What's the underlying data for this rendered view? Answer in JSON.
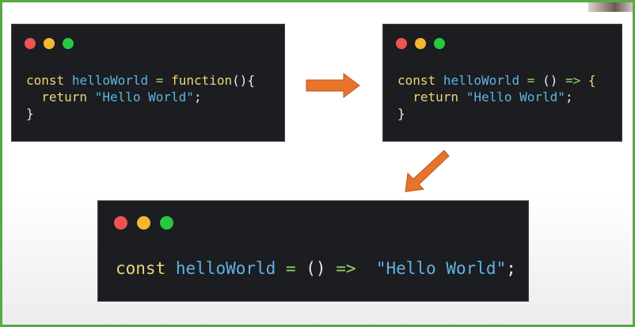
{
  "colors": {
    "frame_border": "#58a845",
    "window_bg": "#1b1d20",
    "keyword": "#f0d575",
    "identifier": "#5fb3e6",
    "operator": "#9ad26a",
    "arrow": "#e8732b"
  },
  "window1": {
    "line1": {
      "kw": "const",
      "id": "helloWorld",
      "op": "=",
      "fn": "function",
      "punc": "(){"
    },
    "line2": {
      "kw": "return",
      "str": "\"Hello World\"",
      "punc": ";"
    },
    "line3": {
      "punc": "}"
    }
  },
  "window2": {
    "line1": {
      "kw": "const",
      "id": "helloWorld",
      "op": "=",
      "parens": "()",
      "arrow": "=>",
      "brace": "{"
    },
    "line2": {
      "kw": "return",
      "str": "\"Hello World\"",
      "punc": ";"
    },
    "line3": {
      "punc": "}"
    }
  },
  "window3": {
    "line1": {
      "kw": "const",
      "id": "helloWorld",
      "op": "=",
      "parens": "()",
      "arrow": "=>",
      "str": "\"Hello World\"",
      "punc": ";"
    }
  }
}
